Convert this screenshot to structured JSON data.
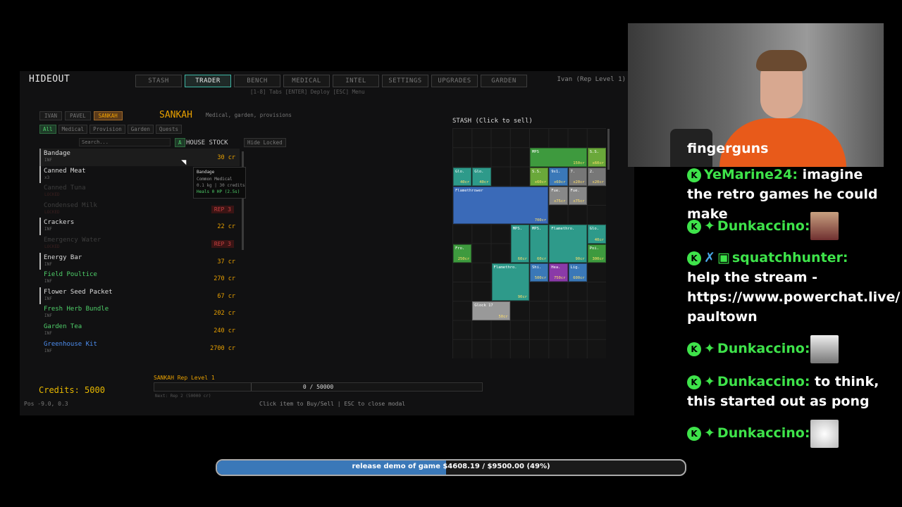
{
  "game": {
    "title": "HIDEOUT",
    "tabs": [
      "STASH",
      "TRADER",
      "BENCH",
      "MEDICAL",
      "INTEL",
      "SETTINGS",
      "UPGRADES",
      "GARDEN"
    ],
    "active_tab": "TRADER",
    "key_hint": "[1-8] Tabs  [ENTER] Deploy  [ESC] Menu",
    "player": "Ivan (Rep Level 1)",
    "traders": [
      "IVAN",
      "PAVEL",
      "SANKAH"
    ],
    "active_trader": "SANKAH",
    "trader_name": "SANKAH",
    "trader_desc": "Medical, garden, provisions",
    "filters": [
      "All",
      "Medical",
      "Provision",
      "Garden",
      "Quests"
    ],
    "search_placeholder": "Search...",
    "sort_label": "A",
    "house_stock": "HOUSE STOCK",
    "hide_locked": "Hide Locked",
    "items": [
      {
        "name": "Bandage",
        "sub": "INF",
        "price": "30 cr",
        "state": "hl"
      },
      {
        "name": "Canned Meat",
        "sub": "x3",
        "price": "",
        "state": "normal"
      },
      {
        "name": "Canned Tuna",
        "sub": "LOCKED",
        "price": "",
        "state": "locked"
      },
      {
        "name": "Condensed Milk",
        "sub": "LOCKED",
        "lock": "REP 3",
        "state": "locked"
      },
      {
        "name": "Crackers",
        "sub": "INF",
        "price": "22 cr",
        "state": "normal"
      },
      {
        "name": "Emergency Water",
        "sub": "LOCKED",
        "lock": "REP 3",
        "state": "locked"
      },
      {
        "name": "Energy Bar",
        "sub": "INF",
        "price": "37 cr",
        "state": "normal"
      },
      {
        "name": "Field Poultice",
        "sub": "INF",
        "price": "270 cr",
        "state": "green"
      },
      {
        "name": "Flower Seed Packet",
        "sub": "INF",
        "price": "67 cr",
        "state": "normal"
      },
      {
        "name": "Fresh Herb Bundle",
        "sub": "INF",
        "price": "202 cr",
        "state": "green"
      },
      {
        "name": "Garden Tea",
        "sub": "INF",
        "price": "240 cr",
        "state": "green"
      },
      {
        "name": "Greenhouse Kit",
        "sub": "INF",
        "price": "2700 cr",
        "state": "blue"
      }
    ],
    "tooltip": {
      "name": "Bandage",
      "type": "Common Medical",
      "stats": "0.1 kg | 30 credits",
      "effect": "Heals 0 HP (2.5s)"
    },
    "stash_title": "STASH (Click to sell)",
    "stash_items": [
      {
        "n": "MPS",
        "p": "150cr",
        "c": "#3e9a3e"
      },
      {
        "n": "S.S.",
        "p": "x60cr",
        "c": "#6aa83a"
      },
      {
        "n": "Glo.",
        "p": "40cr",
        "c": "#2e9a8a"
      },
      {
        "n": "Glo.",
        "p": "40cr",
        "c": "#2e9a8a"
      },
      {
        "n": "S.S.",
        "p": "x60cr",
        "c": "#6aa83a"
      },
      {
        "n": "9x1.",
        "p": "x60cr",
        "c": "#3a78b8"
      },
      {
        "n": "7.",
        "p": "x20cr",
        "c": "#777"
      },
      {
        "n": "2.",
        "p": "x20cr",
        "c": "#777"
      },
      {
        "n": "Flamethrower",
        "p": "700cr",
        "c": "#3a6ab8"
      },
      {
        "n": "Fue.",
        "p": "x75cr",
        "c": "#888"
      },
      {
        "n": "Fue.",
        "p": "x75cr",
        "c": "#888"
      },
      {
        "n": "MPS.",
        "p": "60cr",
        "c": "#2e9a8a"
      },
      {
        "n": "MPS.",
        "p": "60cr",
        "c": "#2e9a8a"
      },
      {
        "n": "Flamethro.",
        "p": "90cr",
        "c": "#2e9a8a"
      },
      {
        "n": "Glo.",
        "p": "40cr",
        "c": "#2e9a8a"
      },
      {
        "n": "Fro.",
        "p": "250cr",
        "c": "#3e9a3e"
      },
      {
        "n": "Poi.",
        "p": "300cr",
        "c": "#3e9a3e"
      },
      {
        "n": "Flamethro.",
        "p": "90cr",
        "c": "#2e9a8a"
      },
      {
        "n": "Shi.",
        "p": "500cr",
        "c": "#3a78b8"
      },
      {
        "n": "Hea.",
        "p": "750cr",
        "c": "#8a3aa8"
      },
      {
        "n": "Lig.",
        "p": "600cr",
        "c": "#3a78b8"
      },
      {
        "n": "Glock 17",
        "p": "50cr",
        "c": "#999"
      }
    ],
    "credits": "Credits: 5000",
    "pos": "Pos -9.0, 0.3",
    "rep_label": "SANKAH Rep Level 1",
    "rep_value": "0 / 50000",
    "rep_fraction": 0,
    "rep_next": "Next: Rep 2 (50000 cr)",
    "bottom_hint": "Click item to Buy/Sell  |  ESC to close modal"
  },
  "chat": {
    "partial": "fingerguns",
    "messages": [
      {
        "user": "YeMarine24:",
        "text": "imagine the retro games he could make"
      },
      {
        "user": "Dunkaccino:",
        "text": ""
      },
      {
        "user": "squatchhunter:",
        "text": "help the stream - https://www.powerchat.live/ paultown"
      },
      {
        "user": "Dunkaccino:",
        "text": ""
      },
      {
        "user": "Dunkaccino:",
        "text": "to think, this started out as pong"
      },
      {
        "user": "Dunkaccino:",
        "text": ""
      }
    ]
  },
  "goal": {
    "text": "release demo of game $4608.19 / $9500.00 (49%)",
    "fraction": 0.49
  }
}
